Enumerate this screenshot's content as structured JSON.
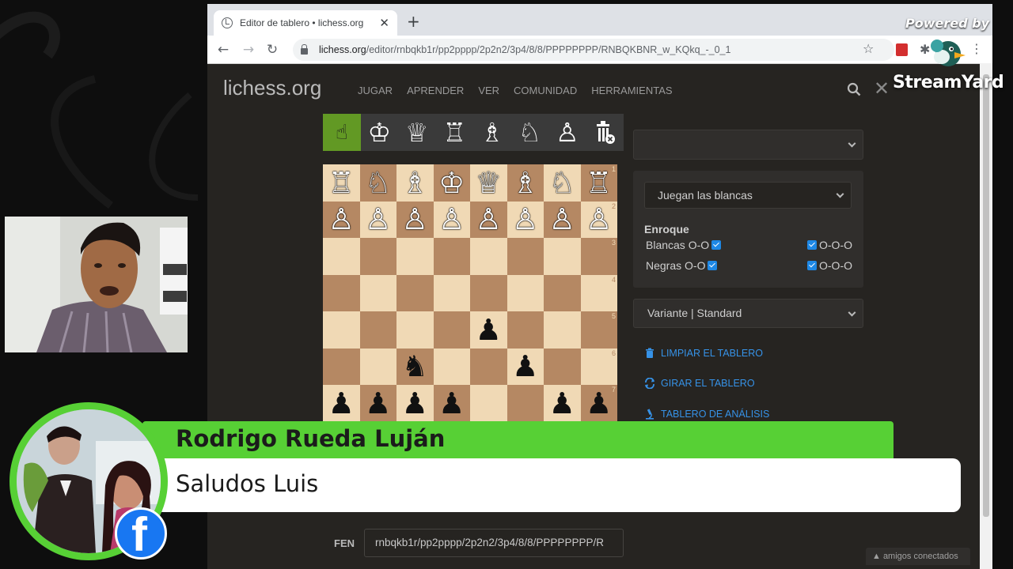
{
  "browser": {
    "tab_title": "Editor de tablero • lichess.org",
    "new_tab": "+",
    "url_host": "lichess.org",
    "url_path": "/editor/rnbqkb1r/pp2pppp/2p2n2/3p4/8/8/PPPPPPPP/RNBQKBNR_w_KQkq_-_0_1"
  },
  "site": {
    "logo": "lichess.org",
    "nav": [
      "JUGAR",
      "APRENDER",
      "VER",
      "COMUNIDAD",
      "HERRAMIENTAS"
    ]
  },
  "board": {
    "rows": [
      [
        "♖",
        "♘",
        "♗",
        "♔",
        "♕",
        "♗",
        "♘",
        "♖"
      ],
      [
        "♙",
        "♙",
        "♙",
        "♙",
        "♙",
        "♙",
        "♙",
        "♙"
      ],
      [
        "",
        "",
        "",
        "",
        "",
        "",
        "",
        ""
      ],
      [
        "",
        "",
        "",
        "",
        "",
        "",
        "",
        ""
      ],
      [
        "",
        "",
        "",
        "",
        "♟",
        "",
        "",
        ""
      ],
      [
        "",
        "",
        "♞",
        "",
        "",
        "♟",
        "",
        ""
      ],
      [
        "♟",
        "♟",
        "♟",
        "♟",
        "",
        "",
        "♟",
        "♟"
      ]
    ],
    "colors": [
      [
        "w",
        "w",
        "w",
        "w",
        "w",
        "w",
        "w",
        "w"
      ],
      [
        "w",
        "w",
        "w",
        "w",
        "w",
        "w",
        "w",
        "w"
      ],
      [
        "",
        "",
        "",
        "",
        "",
        "",
        "",
        ""
      ],
      [
        "",
        "",
        "",
        "",
        "",
        "",
        "",
        ""
      ],
      [
        "",
        "",
        "",
        "",
        "b",
        "",
        "",
        ""
      ],
      [
        "",
        "",
        "b",
        "",
        "",
        "b",
        "",
        ""
      ],
      [
        "b",
        "b",
        "b",
        "b",
        "",
        "",
        "b",
        "b"
      ]
    ],
    "rank_labels": [
      "1",
      "2",
      "3",
      "4",
      "5",
      "6",
      "7"
    ]
  },
  "editor": {
    "turn_select": "Juegan las blancas",
    "castling_title": "Enroque",
    "white_oo": "Blancas O-O",
    "black_oo": "Negras O-O",
    "white_ooo": "O-O-O",
    "black_ooo": "O-O-O",
    "variant_select": "Variante | Standard",
    "clear_board": "LIMPIAR EL TABLERO",
    "flip_board": "GIRAR EL TABLERO",
    "analysis_board": "TABLERO DE ANÁLISIS",
    "fen_label": "FEN",
    "fen_value": "rnbqkb1r/pp2pppp/2p2n2/3p4/8/8/PPPPPPPP/R",
    "friends": "▲ amigos conectados"
  },
  "overlay": {
    "powered_by": "Powered by",
    "brand": "StreamYard",
    "commenter_name": "Rodrigo Rueda Luján",
    "comment": "Saludos Luis",
    "platform_icon": "f"
  },
  "colors": {
    "lichess_bg": "#262421",
    "board_light": "#f0d9b5",
    "board_dark": "#b58863",
    "active_tool": "#629924",
    "link_blue": "#3692e7",
    "banner_green": "#57d035",
    "facebook_blue": "#1877f2"
  }
}
